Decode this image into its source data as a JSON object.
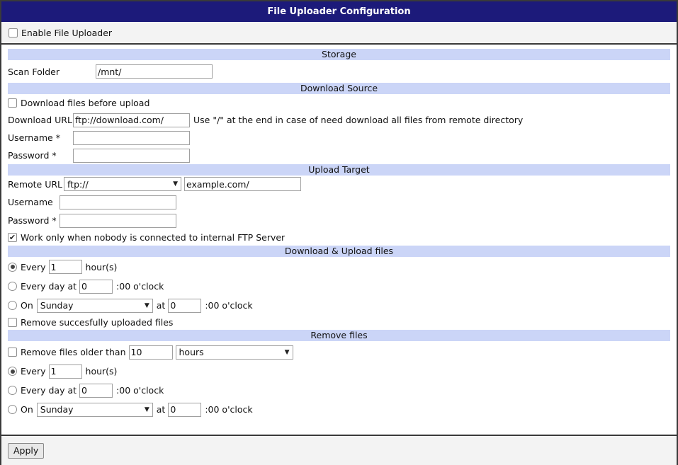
{
  "title": "File Uploader Configuration",
  "enable": {
    "label": "Enable File Uploader",
    "checked": false
  },
  "storage": {
    "header": "Storage",
    "scan_folder_label": "Scan Folder",
    "scan_folder_value": "/mnt/"
  },
  "download_source": {
    "header": "Download Source",
    "download_before_label": "Download files before upload",
    "download_before_checked": false,
    "url_label": "Download URL",
    "url_value": "ftp://download.com/",
    "url_hint": "Use \"/\" at the end in case of need download all files from remote directory",
    "username_label": "Username *",
    "username_value": "",
    "password_label": "Password *",
    "password_value": ""
  },
  "upload_target": {
    "header": "Upload Target",
    "remote_url_label": "Remote URL",
    "protocol_value": "ftp://",
    "remote_url_value": "example.com/",
    "username_label": "Username",
    "username_value": "",
    "password_label": "Password *",
    "password_value": "",
    "work_only_label": "Work only when nobody is connected to internal FTP Server",
    "work_only_checked": true
  },
  "download_upload": {
    "header": "Download & Upload files",
    "every_label": "Every",
    "every_value": "1",
    "every_unit": "hour(s)",
    "every_day_label": "Every day at",
    "every_day_value": "0",
    "oclock_suffix": ":00 o'clock",
    "on_label": "On",
    "on_day_value": "Sunday",
    "at_label": "at",
    "on_hour_value": "0",
    "selected_option": "every",
    "remove_uploaded_label": "Remove succesfully uploaded files",
    "remove_uploaded_checked": false
  },
  "remove_files": {
    "header": "Remove files",
    "older_than_label": "Remove files older than",
    "older_than_checked": false,
    "older_than_value": "10",
    "older_than_unit": "hours",
    "every_label": "Every",
    "every_value": "1",
    "every_unit": "hour(s)",
    "every_day_label": "Every day at",
    "every_day_value": "0",
    "oclock_suffix": ":00 o'clock",
    "on_label": "On",
    "on_day_value": "Sunday",
    "at_label": "at",
    "on_hour_value": "0",
    "selected_option": "every"
  },
  "apply_label": "Apply",
  "icons": {
    "dropdown": "chevron-down-icon",
    "checkbox_checked": "check-icon"
  }
}
